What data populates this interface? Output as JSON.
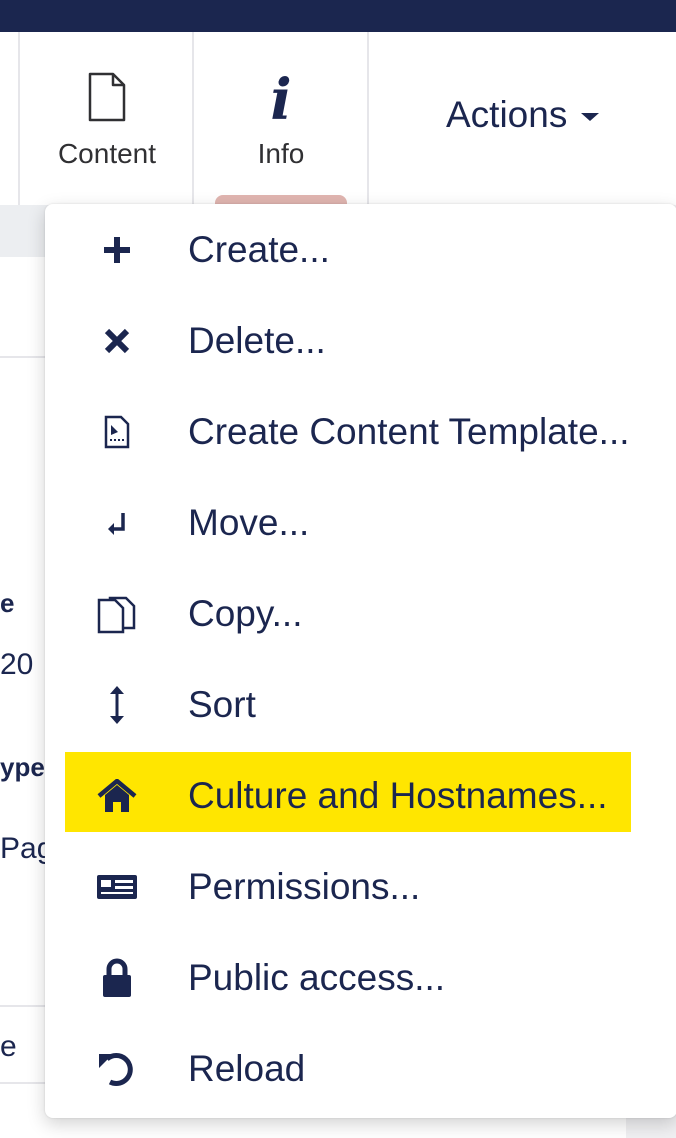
{
  "header": {
    "tabs": [
      {
        "label": "Content",
        "icon": "document-icon"
      },
      {
        "label": "Info",
        "icon": "info-icon"
      }
    ],
    "actions_label": "Actions"
  },
  "background_page": {
    "fragments": [
      "e",
      "20",
      "ype",
      "Pag",
      "e"
    ]
  },
  "actions_menu": {
    "items": [
      {
        "label": "Create...",
        "icon": "plus-icon"
      },
      {
        "label": "Delete...",
        "icon": "close-icon"
      },
      {
        "label": "Create Content Template...",
        "icon": "template-icon"
      },
      {
        "label": "Move...",
        "icon": "move-icon"
      },
      {
        "label": "Copy...",
        "icon": "copy-icon"
      },
      {
        "label": "Sort",
        "icon": "sort-icon"
      },
      {
        "label": "Culture and Hostnames...",
        "icon": "home-icon",
        "highlighted": true
      },
      {
        "label": "Permissions...",
        "icon": "permissions-icon"
      },
      {
        "label": "Public access...",
        "icon": "lock-icon"
      },
      {
        "label": "Reload",
        "icon": "reload-icon"
      }
    ]
  },
  "colors": {
    "topbar": "#1b264f",
    "text": "#1b264f",
    "highlight": "#ffe600",
    "active_tab_indicator": "#e0b5b0"
  }
}
